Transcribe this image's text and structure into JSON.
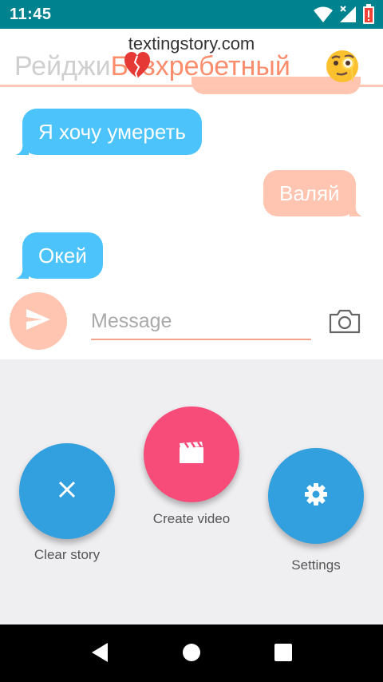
{
  "status_bar": {
    "time": "11:45",
    "icons": [
      "wifi-icon",
      "signal-icon",
      "battery-alert-icon"
    ],
    "color": "#00838f"
  },
  "header": {
    "watermark": "textingstory.com",
    "title_left": "Рейджи",
    "title_right": "Безхребетный",
    "heart_icon": "broken-heart-icon",
    "monocle_icon": "face-with-monocle-icon"
  },
  "messages": [
    {
      "side": "received",
      "text": "Я хочу умереть"
    },
    {
      "side": "sent",
      "text": "Валяй"
    },
    {
      "side": "received",
      "text": "Окей"
    }
  ],
  "composer": {
    "placeholder": "Message",
    "send_icon": "send-icon",
    "camera_icon": "camera-icon"
  },
  "actions": {
    "clear_story": "Clear story",
    "create_video": "Create video",
    "settings": "Settings"
  },
  "nav": {
    "back_icon": "back-icon",
    "home_icon": "home-icon",
    "recents_icon": "recents-icon"
  },
  "colors": {
    "received_bubble": "#4cc3fa",
    "sent_bubble": "#ffc5b0",
    "fab_blue": "#329fdf",
    "fab_pink": "#f74c7a",
    "accent_orange": "#fb8d6c"
  }
}
